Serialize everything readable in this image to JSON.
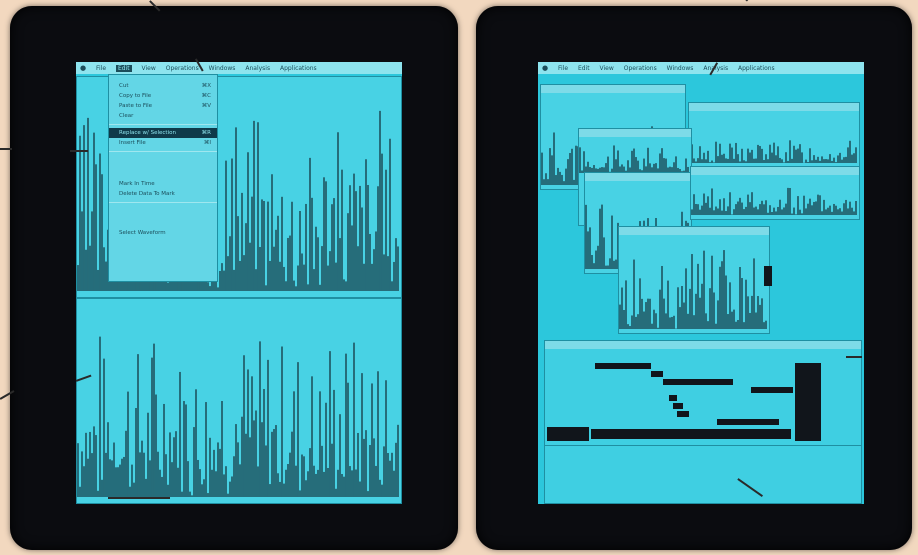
{
  "left_monitor": {
    "menubar": {
      "items": [
        "File",
        "Edit",
        "View",
        "Operations",
        "Windows",
        "Analysis",
        "Applications"
      ],
      "selected_index": 1
    },
    "edit_menu": {
      "items": [
        {
          "label": "Cut",
          "shortcut": "⌘X"
        },
        {
          "label": "Copy to File",
          "shortcut": "⌘C"
        },
        {
          "label": "Paste to File",
          "shortcut": "⌘V"
        },
        {
          "label": "Clear",
          "shortcut": ""
        },
        {
          "label": "Replace w/ Selection",
          "shortcut": "⌘R",
          "highlighted": true
        },
        {
          "label": "Insert File",
          "shortcut": "⌘I"
        },
        {
          "label": "Mark In Time",
          "shortcut": ""
        },
        {
          "label": "Delete Data To Mark",
          "shortcut": ""
        },
        {
          "label": "Select Waveform",
          "shortcut": ""
        }
      ]
    }
  },
  "right_monitor": {
    "menubar": {
      "items": [
        "File",
        "Edit",
        "View",
        "Operations",
        "Windows",
        "Analysis",
        "Applications"
      ],
      "selected_index": -1
    }
  },
  "colors": {
    "screen": "#2cc7dc",
    "bezel": "#0b0c10",
    "background": "#f2d8bf",
    "waveform": "#0f2a35"
  }
}
